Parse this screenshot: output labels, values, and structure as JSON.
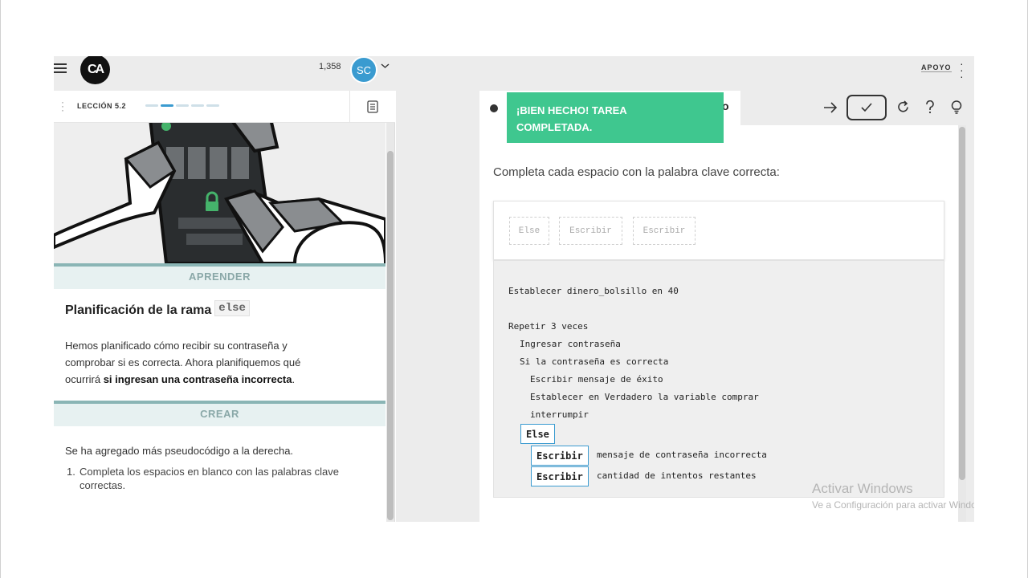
{
  "header": {
    "logo_text": "CA",
    "points": "1,358",
    "avatar_initials": "SC",
    "support_label": "APOYO"
  },
  "lesson": {
    "label": "LECCIÓN 5.2",
    "progress_total": 5,
    "progress_current": 2
  },
  "learn": {
    "section_label": "APRENDER",
    "title": "Planificación de la rama",
    "title_code": "else",
    "para_before": "Hemos planificado cómo recibir su contraseña y comprobar si es correcta. Ahora planifiquemos qué ocurrirá ",
    "para_bold": "si ingresan una contraseña incorrecta",
    "para_after": "."
  },
  "create": {
    "section_label": "CREAR",
    "intro": "Se ha agregado más pseudocódigo a la derecha.",
    "steps": [
      "Completa los espacios en blanco con las palabras clave correctas."
    ]
  },
  "toast": {
    "line1": "¡BIEN HECHO! TAREA",
    "line2": "COMPLETADA."
  },
  "tab": {
    "trailing_char": "o"
  },
  "exercise": {
    "prompt": "Completa cada espacio con la palabra clave correcta:",
    "bank": [
      "Else",
      "Escribir",
      "Escribir"
    ],
    "code_lines": {
      "l1": "Establecer dinero_bolsillo en 40",
      "l2": "Repetir 3 veces",
      "l3": "Ingresar contraseña",
      "l4": "Si la contraseña es correcta",
      "l5": "Escribir mensaje de éxito",
      "l6": "Establecer en Verdadero la variable comprar",
      "l7": "interrumpir",
      "l8": "mensaje de contraseña incorrecta",
      "l9": "cantidad de intentos restantes"
    },
    "slots": {
      "s1": "Else",
      "s2": "Escribir",
      "s3": "Escribir"
    }
  },
  "watermark": {
    "line1": "Activar Windows",
    "line2": "Ve a Configuración para activar Windows."
  },
  "colors": {
    "accent": "#3a9bd0",
    "success": "#3fc78f",
    "section_bar": "#8ab5b5"
  }
}
